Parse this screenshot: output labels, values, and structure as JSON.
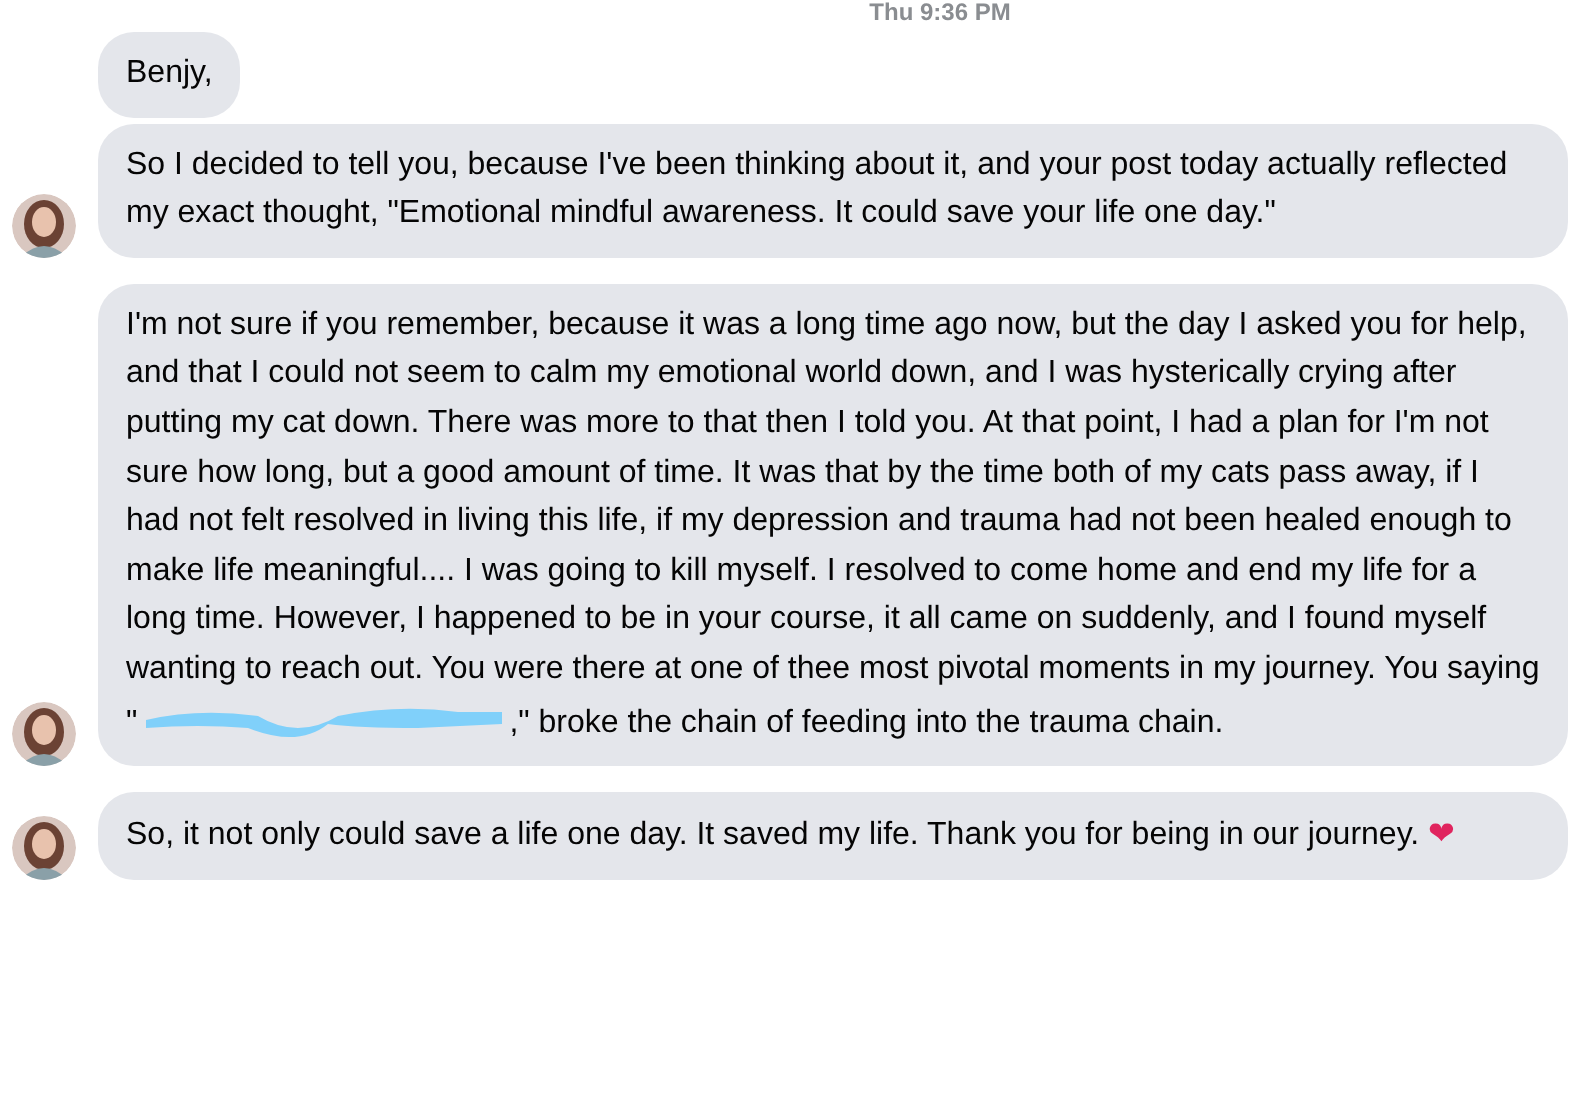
{
  "timestamp": "Thu 9:36 PM",
  "messages": [
    {
      "avatar": false,
      "parts": [
        {
          "kind": "text",
          "text": "Benjy,"
        }
      ]
    },
    {
      "avatar": true,
      "parts": [
        {
          "kind": "text",
          "text": "So I decided to tell you, because I've been thinking about it, and your post today actually reflected my exact thought, \"Emotional mindful awareness. It could save your life one day.\""
        }
      ]
    },
    {
      "avatar": true,
      "parts": [
        {
          "kind": "text",
          "text": "I'm not sure if you remember, because it was a long time ago now, but the day I asked you for help, and that I could not seem to calm my emotional world down, and I was hysterically crying after putting my cat down. There was more to that then I told you. At that point, I had a plan for I'm not sure how long, but a good amount of time. It was that by the time both of my cats pass away, if I had not felt resolved in living this life, if my depression and trauma had not been healed enough to make life meaningful.... I was going to kill myself. I resolved to come home and end my life for a long time. However, I happened to be in your course, it all came on suddenly, and I found myself wanting to reach out. You were there at one of thee most pivotal moments in my journey. You saying \""
        },
        {
          "kind": "redacted"
        },
        {
          "kind": "text",
          "text": ",\" broke the chain of feeding into the trauma chain."
        }
      ]
    },
    {
      "avatar": true,
      "parts": [
        {
          "kind": "text",
          "text": "So, it not only could save a life one day. It saved my life. Thank you for being in our journey. "
        },
        {
          "kind": "emoji",
          "text": "❤"
        }
      ]
    }
  ]
}
